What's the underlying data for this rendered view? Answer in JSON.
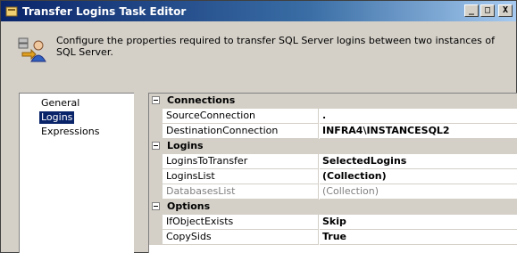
{
  "window": {
    "title": "Transfer Logins Task Editor",
    "minimize_glyph": "_",
    "maximize_glyph": "□",
    "close_glyph": "X"
  },
  "header": {
    "description": "Configure the properties required to transfer SQL Server logins between two instances of SQL Server.",
    "icon": "transfer-logins-icon"
  },
  "nav": {
    "items": [
      {
        "label": "General"
      },
      {
        "label": "Logins",
        "selected": true
      },
      {
        "label": "Expressions"
      }
    ]
  },
  "properties": {
    "categories": [
      {
        "name": "Connections",
        "rows": [
          {
            "name": "SourceConnection",
            "value": "."
          },
          {
            "name": "DestinationConnection",
            "value": "INFRA4\\INSTANCESQL2"
          }
        ]
      },
      {
        "name": "Logins",
        "rows": [
          {
            "name": "LoginsToTransfer",
            "value": "SelectedLogins"
          },
          {
            "name": "LoginsList",
            "value": "(Collection)"
          },
          {
            "name": "DatabasesList",
            "value": "(Collection)",
            "disabled": true
          }
        ]
      },
      {
        "name": "Options",
        "rows": [
          {
            "name": "IfObjectExists",
            "value": "Skip"
          },
          {
            "name": "CopySids",
            "value": "True"
          }
        ]
      }
    ]
  },
  "colors": {
    "titlebar_start": "#0a246a",
    "titlebar_end": "#a6caf0",
    "face": "#d4d0c8",
    "selection": "#0a246a",
    "disabled_text": "#808080"
  }
}
